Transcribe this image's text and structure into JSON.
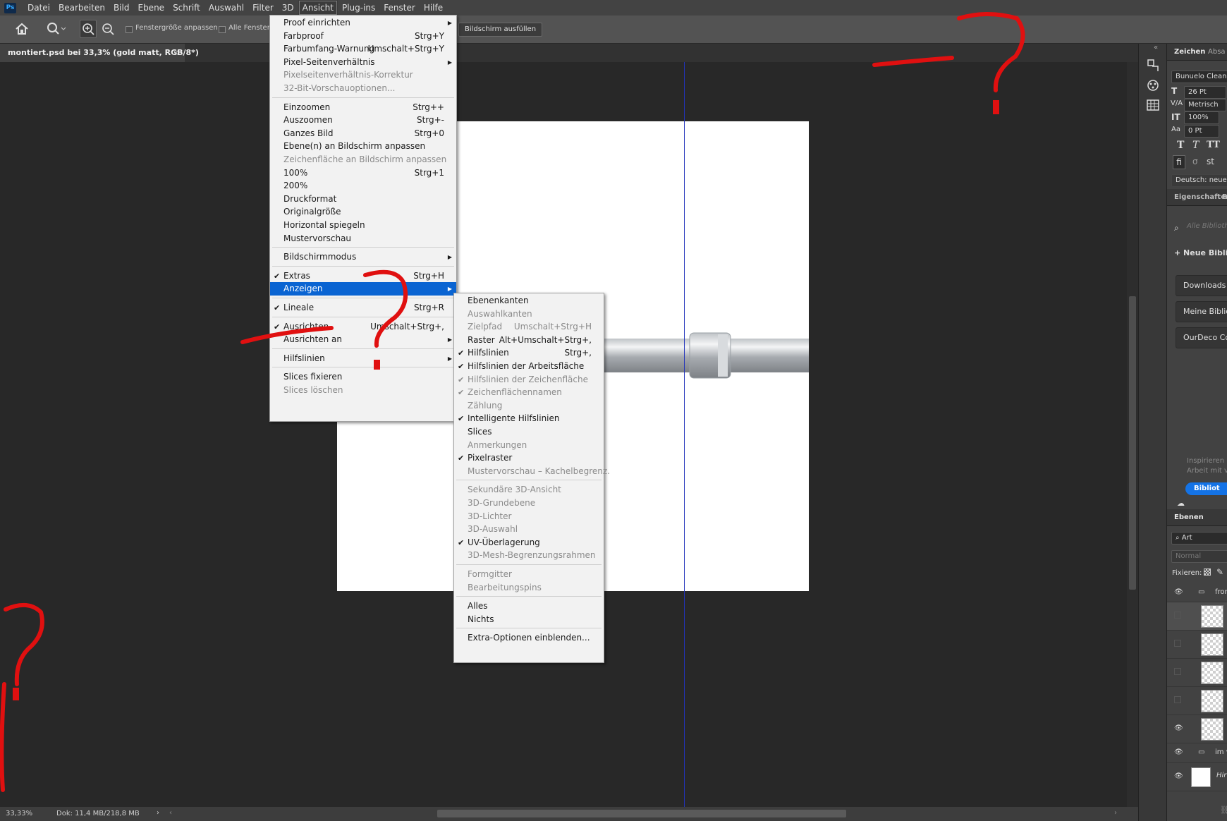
{
  "app": {
    "logo": "Ps"
  },
  "menubar": {
    "items": [
      "Datei",
      "Bearbeiten",
      "Bild",
      "Ebene",
      "Schrift",
      "Auswahl",
      "Filter",
      "3D",
      "Ansicht",
      "Plug-ins",
      "Fenster",
      "Hilfe"
    ],
    "active": "Ansicht"
  },
  "options": {
    "fit_window": "Fenstergröße anpassen",
    "all_windows": "Alle Fenster",
    "fill_screen": "Bildschirm ausfüllen"
  },
  "document": {
    "tab_title": "montiert.psd bei 33,3% (gold matt, RGB/8*)",
    "close": "×"
  },
  "status": {
    "zoom": "33,33%",
    "doc": "Dok: 11,4 MB/218,8 MB",
    "more": "›",
    "scroll_left": "‹",
    "scroll_right": "›"
  },
  "ansicht_menu": [
    {
      "label": "Proof einrichten",
      "submenu": true
    },
    {
      "label": "Farbproof",
      "shortcut": "Strg+Y"
    },
    {
      "label": "Farbumfang-Warnung",
      "shortcut": "Umschalt+Strg+Y"
    },
    {
      "label": "Pixel-Seitenverhältnis",
      "submenu": true
    },
    {
      "label": "Pixelseitenverhältnis-Korrektur",
      "disabled": true
    },
    {
      "label": "32-Bit-Vorschauoptionen...",
      "disabled": true
    },
    {
      "sep": true
    },
    {
      "label": "Einzoomen",
      "shortcut": "Strg++"
    },
    {
      "label": "Auszoomen",
      "shortcut": "Strg+-"
    },
    {
      "label": "Ganzes Bild",
      "shortcut": "Strg+0"
    },
    {
      "label": "Ebene(n) an Bildschirm anpassen"
    },
    {
      "label": "Zeichenfläche an Bildschirm anpassen",
      "disabled": true
    },
    {
      "label": "100%",
      "shortcut": "Strg+1"
    },
    {
      "label": "200%"
    },
    {
      "label": "Druckformat"
    },
    {
      "label": "Originalgröße"
    },
    {
      "label": "Horizontal spiegeln"
    },
    {
      "label": "Mustervorschau"
    },
    {
      "sep": true
    },
    {
      "label": "Bildschirmmodus",
      "submenu": true
    },
    {
      "sep": true
    },
    {
      "label": "Extras",
      "shortcut": "Strg+H",
      "checked": true
    },
    {
      "label": "Anzeigen",
      "submenu": true,
      "highlighted": true
    },
    {
      "sep": true
    },
    {
      "label": "Lineale",
      "shortcut": "Strg+R",
      "checked": true
    },
    {
      "sep": true
    },
    {
      "label": "Ausrichten",
      "shortcut": "Umschalt+Strg+,",
      "checked": true
    },
    {
      "label": "Ausrichten an",
      "submenu": true
    },
    {
      "sep": true
    },
    {
      "label": "Hilfslinien",
      "submenu": true
    },
    {
      "sep": true
    },
    {
      "label": "Slices fixieren"
    },
    {
      "label": "Slices löschen",
      "disabled": true
    }
  ],
  "anzeigen_submenu": [
    {
      "label": "Ebenenkanten"
    },
    {
      "label": "Auswahlkanten",
      "disabled": true
    },
    {
      "label": "Zielpfad",
      "shortcut": "Umschalt+Strg+H",
      "disabled": true
    },
    {
      "label": "Raster",
      "shortcut": "Alt+Umschalt+Strg+,"
    },
    {
      "label": "Hilfslinien",
      "shortcut": "Strg+,",
      "checked": true
    },
    {
      "label": "Hilfslinien der Arbeitsfläche",
      "checked": true
    },
    {
      "label": "Hilfslinien der Zeichenfläche",
      "checked": true,
      "disabled": true
    },
    {
      "label": "Zeichenflächennamen",
      "checked": true,
      "disabled": true
    },
    {
      "label": "Zählung",
      "disabled": true
    },
    {
      "label": "Intelligente Hilfslinien",
      "checked": true
    },
    {
      "label": "Slices"
    },
    {
      "label": "Anmerkungen",
      "disabled": true
    },
    {
      "label": "Pixelraster",
      "checked": true
    },
    {
      "label": "Mustervorschau – Kachelbegrenz.",
      "disabled": true
    },
    {
      "sep": true
    },
    {
      "label": "Sekundäre 3D-Ansicht",
      "disabled": true
    },
    {
      "label": "3D-Grundebene",
      "disabled": true
    },
    {
      "label": "3D-Lichter",
      "disabled": true
    },
    {
      "label": "3D-Auswahl",
      "disabled": true
    },
    {
      "label": "UV-Überlagerung",
      "checked": true
    },
    {
      "label": "3D-Mesh-Begrenzungsrahmen",
      "disabled": true
    },
    {
      "sep": true
    },
    {
      "label": "Formgitter",
      "disabled": true
    },
    {
      "label": "Bearbeitungspins",
      "disabled": true
    },
    {
      "sep": true
    },
    {
      "label": "Alles"
    },
    {
      "label": "Nichts"
    },
    {
      "sep": true
    },
    {
      "label": "Extra-Optionen einblenden..."
    }
  ],
  "character_panel": {
    "tab": "Zeichen",
    "tab2": "Absa",
    "font": "Bunuelo Clean Pr",
    "size": "26 Pt",
    "kerning": "Metrisch",
    "vscale": "100%",
    "baseline": "0 Pt",
    "language": "Deutsch: neue R"
  },
  "libraries_panel": {
    "tab": "Eigenschaften",
    "tab2": "B",
    "search_placeholder": "Alle Biblioth",
    "new_library": "Neue Biblic",
    "items": [
      "Downloads",
      "Meine Bibliot",
      "OurDeco Colo"
    ],
    "inspire1": "Inspirieren u",
    "inspire2": "Arbeit mit v",
    "cta": "Bibliot"
  },
  "layers_panel": {
    "tab": "Ebenen",
    "filter": "Art",
    "blend": "Normal",
    "lock_label": "Fixieren:",
    "groups": [
      "fron",
      "im v"
    ],
    "bg_layer": "Hir"
  },
  "colors": {
    "accent": "#0a64d2",
    "guide": "#2233bb",
    "annotation": "#e01010"
  }
}
